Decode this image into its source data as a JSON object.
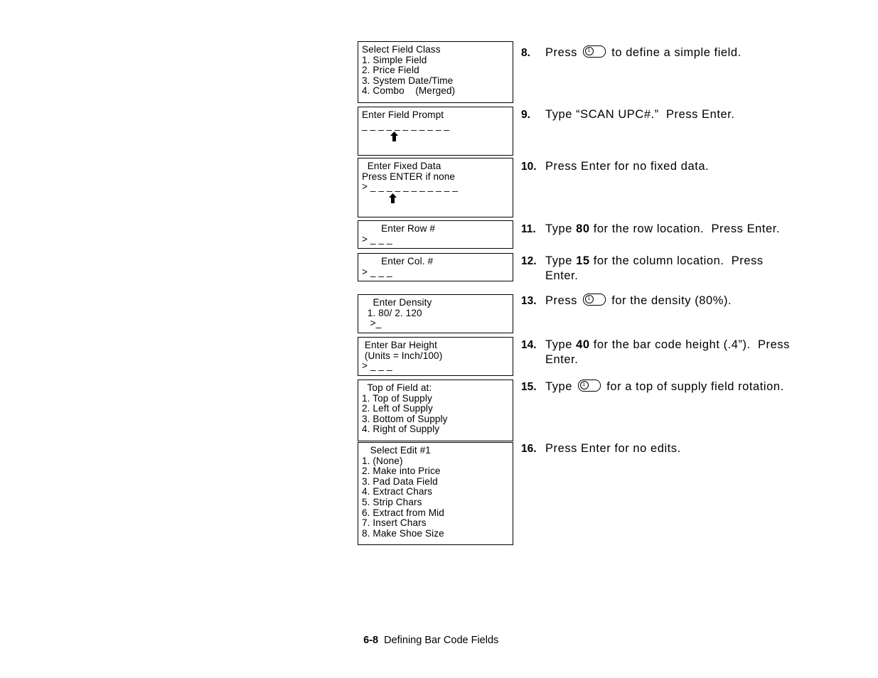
{
  "document": {
    "footer": {
      "page_number": "6-8",
      "chapter_title": "Defining Bar Code Fields"
    }
  },
  "lcd_screens": [
    {
      "name": "select-field-class",
      "lines": [
        "Select Field Class",
        "1. Simple Field",
        "2. Price Field",
        "3. System Date/Time",
        "4. Combo    (Merged)"
      ]
    },
    {
      "name": "enter-field-prompt",
      "lines": [
        "Enter Field Prompt",
        "_ _ _ _ _ _ _ _ _ _ _",
        "caret"
      ]
    },
    {
      "name": "enter-fixed-data",
      "lines": [
        "  Enter Fixed Data",
        "Press ENTER if none",
        "> _ _ _ _ _ _ _ _ _ _ _",
        "caret"
      ]
    },
    {
      "name": "enter-row-number",
      "lines": [
        "       Enter Row #",
        "> _ _ _"
      ]
    },
    {
      "name": "enter-column-number",
      "lines": [
        "       Enter Col. #",
        "> _ _ _"
      ]
    },
    {
      "name": "enter-density",
      "lines": [
        "    Enter Density",
        "  1. 80/ 2. 120",
        "   >_"
      ]
    },
    {
      "name": "enter-bar-height",
      "lines": [
        " Enter Bar Height",
        " (Units = Inch/100)",
        "> _ _ _"
      ]
    },
    {
      "name": "top-of-field-at",
      "lines": [
        "  Top of Field at:",
        "1. Top of Supply",
        "2. Left of Supply",
        "3. Bottom of Supply",
        "4. Right of Supply"
      ]
    },
    {
      "name": "select-edit-1",
      "lines": [
        "   Select Edit #1",
        "1. (None)",
        "2. Make into Price",
        "3. Pad Data Field",
        "4. Extract Chars",
        "5. Strip Chars",
        "6. Extract from Mid",
        "7. Insert Chars",
        "8. Make Shoe Size"
      ]
    }
  ],
  "steps": [
    {
      "number": "8.",
      "parts": [
        {
          "type": "text",
          "value": "Press "
        },
        {
          "type": "key",
          "value": "1"
        },
        {
          "type": "text",
          "value": " to define a simple field."
        }
      ]
    },
    {
      "number": "9.",
      "parts": [
        {
          "type": "text",
          "value": "Type “SCAN UPC#.”  Press Enter."
        }
      ]
    },
    {
      "number": "10.",
      "parts": [
        {
          "type": "text",
          "value": "Press Enter for no fixed data."
        }
      ]
    },
    {
      "number": "11.",
      "parts": [
        {
          "type": "text",
          "value": "Type "
        },
        {
          "type": "bold",
          "value": "80"
        },
        {
          "type": "text",
          "value": " for the row location.  Press Enter."
        }
      ]
    },
    {
      "number": "12.",
      "parts": [
        {
          "type": "text",
          "value": "Type "
        },
        {
          "type": "bold",
          "value": "15"
        },
        {
          "type": "text",
          "value": " for the column location.  Press\nEnter."
        }
      ]
    },
    {
      "number": "13.",
      "parts": [
        {
          "type": "text",
          "value": "Press "
        },
        {
          "type": "key",
          "value": "1"
        },
        {
          "type": "text",
          "value": " for the density (80%)."
        }
      ]
    },
    {
      "number": "14.",
      "parts": [
        {
          "type": "text",
          "value": "Type "
        },
        {
          "type": "bold",
          "value": "40"
        },
        {
          "type": "text",
          "value": " for the bar code height (.4”).  Press\nEnter."
        }
      ]
    },
    {
      "number": "15.",
      "parts": [
        {
          "type": "text",
          "value": "Type "
        },
        {
          "type": "key",
          "value": "1"
        },
        {
          "type": "text",
          "value": " for a top of supply field rotation."
        }
      ]
    },
    {
      "number": "16.",
      "parts": [
        {
          "type": "text",
          "value": "Press Enter for no edits."
        }
      ]
    }
  ],
  "layout": {
    "lcd_tops": [
      58,
      146,
      218,
      306,
      352,
      410,
      470,
      530,
      618
    ],
    "step_tops": [
      4,
      91,
      164,
      252,
      297,
      353,
      415,
      474,
      561
    ]
  },
  "colors": {
    "ink": "#000000",
    "paper": "#ffffff"
  }
}
